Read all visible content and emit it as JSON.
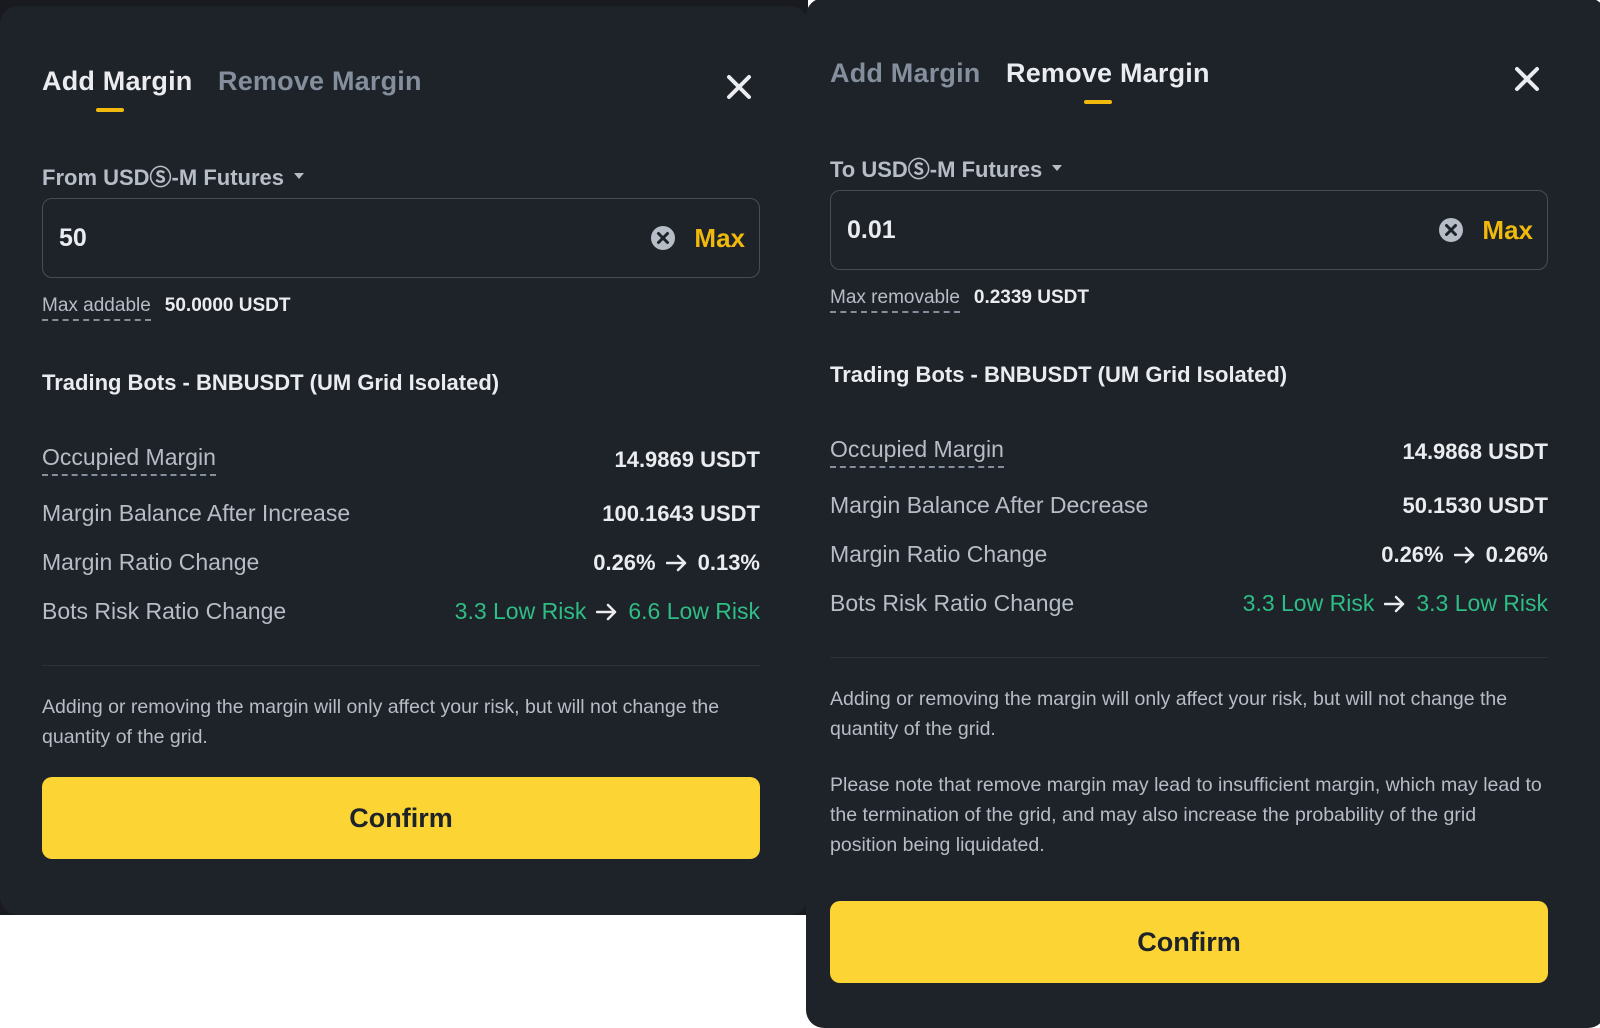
{
  "colors": {
    "accent": "#f0b90b",
    "confirm_bg": "#fcd535",
    "positive": "#2ebd85",
    "panel_bg": "#1e2329"
  },
  "left": {
    "tabs": [
      {
        "label": "Add Margin",
        "active": true
      },
      {
        "label": "Remove Margin",
        "active": false
      }
    ],
    "source_label": "From USDⓈ-M Futures",
    "amount_value": "50",
    "max_label": "Max",
    "limit_label": "Max addable",
    "limit_value": "50.0000 USDT",
    "section_title": "Trading Bots - BNBUSDT (UM Grid Isolated)",
    "rows": [
      {
        "label": "Occupied Margin",
        "value": "14.9869 USDT"
      },
      {
        "label": "Margin Balance After Increase",
        "value": "100.1643 USDT"
      },
      {
        "label": "Margin Ratio Change",
        "from": "0.26%",
        "to": "0.13%"
      },
      {
        "label": "Bots Risk Ratio Change",
        "from": "3.3 Low Risk",
        "to": "6.6 Low Risk"
      }
    ],
    "note": "Adding or removing the margin will only affect your risk, but will not change the quantity of the grid.",
    "confirm_label": "Confirm"
  },
  "right": {
    "tabs": [
      {
        "label": "Add Margin",
        "active": false
      },
      {
        "label": "Remove Margin",
        "active": true
      }
    ],
    "source_label": "To USDⓈ-M Futures",
    "amount_value": "0.01",
    "max_label": "Max",
    "limit_label": "Max removable",
    "limit_value": "0.2339 USDT",
    "section_title": "Trading Bots - BNBUSDT (UM Grid Isolated)",
    "rows": [
      {
        "label": "Occupied Margin",
        "value": "14.9868 USDT"
      },
      {
        "label": "Margin Balance After Decrease",
        "value": "50.1530 USDT"
      },
      {
        "label": "Margin Ratio Change",
        "from": "0.26%",
        "to": "0.26%"
      },
      {
        "label": "Bots Risk Ratio Change",
        "from": "3.3 Low Risk",
        "to": "3.3 Low Risk"
      }
    ],
    "note": "Adding or removing the margin will only affect your risk, but will not change the quantity of the grid.",
    "warning": "Please note that remove margin may lead to insufficient margin, which may lead to the termination of the grid, and may also increase the probability of the grid position being liquidated.",
    "confirm_label": "Confirm"
  },
  "icons": {
    "close": "close-icon",
    "clear": "clear-input-icon",
    "dropdown": "caret-down-icon",
    "arrow": "arrow-right-icon"
  }
}
